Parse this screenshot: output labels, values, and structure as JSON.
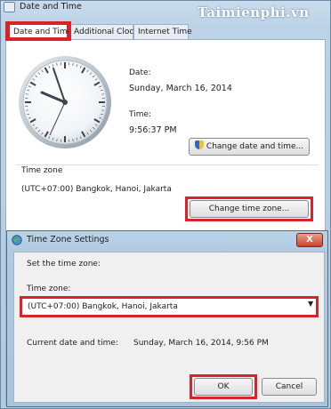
{
  "date_time_window": {
    "title": "Date and Time",
    "tabs": [
      {
        "label": "Date and Time",
        "active": true
      },
      {
        "label": "Additional Clocks",
        "active": false
      },
      {
        "label": "Internet Time",
        "active": false
      }
    ],
    "date_label": "Date:",
    "date_value": "Sunday, March 16, 2014",
    "time_label": "Time:",
    "time_value": "9:56:37 PM",
    "change_date_button": "Change date and time...",
    "time_zone_label": "Time zone",
    "time_zone_value": "(UTC+07:00) Bangkok, Hanoi, Jakarta",
    "change_time_zone_button": "Change time zone..."
  },
  "time_zone_dialog": {
    "title": "Time Zone Settings",
    "close_symbol": "X",
    "instruction": "Set the time zone:",
    "time_zone_label": "Time zone:",
    "selected_time_zone": "(UTC+07:00) Bangkok, Hanoi, Jakarta",
    "current_label": "Current date and time:",
    "current_value": "Sunday, March 16, 2014, 9:56 PM",
    "ok_button": "OK",
    "cancel_button": "Cancel"
  },
  "watermark": "Taimienphi.vn",
  "colors": {
    "highlight": "#d8232a",
    "window_chrome": "#b3cbe1"
  },
  "icons": [
    "calendar-clock-icon",
    "shield-icon",
    "globe-icon",
    "chevron-down-icon",
    "close-icon"
  ]
}
